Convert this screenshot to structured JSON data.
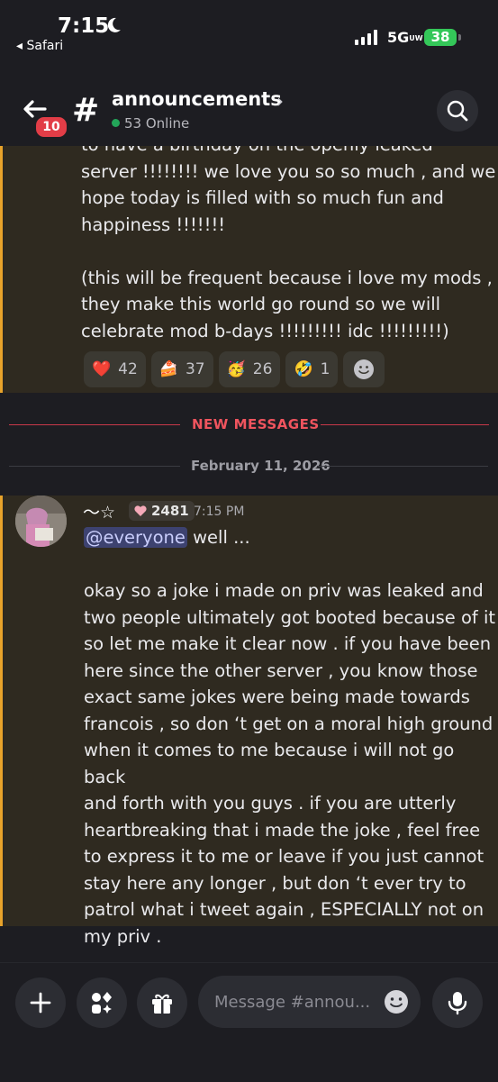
{
  "status_bar": {
    "time": "7:15",
    "back_app": "Safari",
    "network": "5G",
    "network_suffix": "UW",
    "battery": "38"
  },
  "header": {
    "unread_count": "10",
    "channel_icon": "#",
    "channel_name": "announcements",
    "online": "53 Online"
  },
  "previous_message": {
    "lines": [
      "to have a birthday on the openly leaked",
      "server !!!!!!!! we love you so so much , and we",
      "hope today is filled with so much fun and",
      "happiness !!!!!!!",
      "",
      "(this will be frequent because i love my mods ,",
      "they make this world go round so we will",
      "celebrate mod b-days !!!!!!!!! idc !!!!!!!!!)"
    ],
    "reactions": [
      {
        "emoji": "❤️",
        "count": "42",
        "icon": "heart-icon"
      },
      {
        "emoji": "🍰",
        "count": "37",
        "icon": "cake-icon"
      },
      {
        "emoji": "🥳",
        "count": "26",
        "icon": "party-face-icon"
      },
      {
        "emoji": "🤣",
        "count": "1",
        "icon": "rofl-face-icon"
      }
    ]
  },
  "dividers": {
    "new_messages": "NEW MESSAGES",
    "date": "February 11, 2026"
  },
  "message": {
    "author": "〜☆",
    "role_count": "2481",
    "timestamp": "7:15 PM",
    "mention": "@everyone",
    "first_line_rest": " well ...",
    "body_lines": [
      "okay so a joke i made on priv was leaked and",
      "two people ultimately got booted because of it",
      "so let me make it clear now . if you have been",
      "here since the other server , you know those",
      "exact same jokes were being made towards",
      "francois , so don ‘t get on a moral high ground",
      "when it comes to me because i will not go back",
      "and forth with you guys . if you are utterly",
      "heartbreaking that i made the joke , feel free",
      "to express it to me or leave if you just cannot",
      "stay here any longer , but don ‘t ever try to",
      "patrol what i tweet again , ESPECIALLY not on",
      "my priv ."
    ]
  },
  "composer": {
    "placeholder": "Message #annou..."
  },
  "colors": {
    "highlight_bar": "#e8a32b",
    "new_messages": "#f0545e",
    "online_dot": "#23a559",
    "badge": "#e23d47"
  }
}
